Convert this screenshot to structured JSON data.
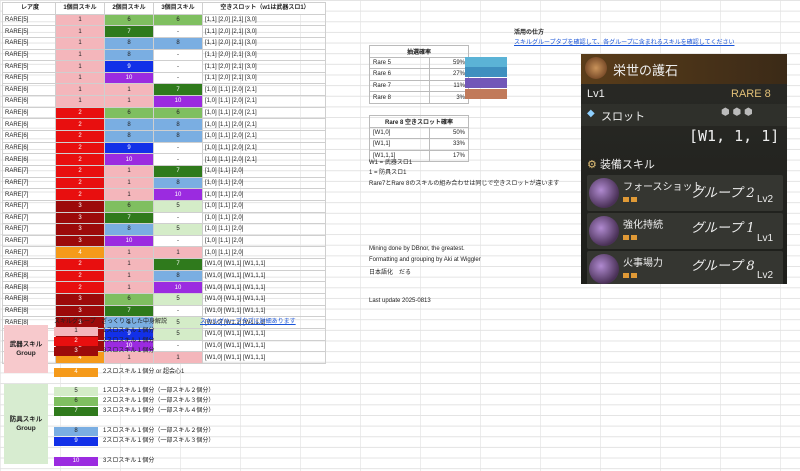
{
  "sheet": {
    "headers": [
      "レア度",
      "1個目スキル",
      "2個目スキル",
      "3個目スキル",
      "空きスロット（w1は武器スロ1）"
    ],
    "rows": [
      {
        "r": "RARE[5]",
        "s1": "1",
        "s2": "6",
        "s3": "6",
        "slot": "[1,1] [2,0] [2,1] [3,0]",
        "k1": "p",
        "k2": "g6",
        "k3": "g6",
        "sep": false
      },
      {
        "r": "RARE[5]",
        "s1": "1",
        "s2": "7",
        "s3": "-",
        "slot": "[1,1] [2,0] [2,1] [3,0]",
        "k1": "p",
        "k2": "g7",
        "k3": "w",
        "sep": false
      },
      {
        "r": "RARE[5]",
        "s1": "1",
        "s2": "8",
        "s3": "8",
        "slot": "[1,1] [2,0] [2,1] [3,0]",
        "k1": "p",
        "k2": "b8",
        "k3": "b8",
        "sep": false
      },
      {
        "r": "RARE[5]",
        "s1": "1",
        "s2": "8",
        "s3": "-",
        "slot": "[1,1] [2,0] [2,1] [3,0]",
        "k1": "p",
        "k2": "b8",
        "k3": "w",
        "sep": false
      },
      {
        "r": "RARE[5]",
        "s1": "1",
        "s2": "9",
        "s3": "-",
        "slot": "[1,1] [2,0] [2,1] [3,0]",
        "k1": "p",
        "k2": "b9",
        "k3": "w",
        "sep": false
      },
      {
        "r": "RARE[5]",
        "s1": "1",
        "s2": "10",
        "s3": "-",
        "slot": "[1,1] [2,0] [2,1] [3,0]",
        "k1": "p",
        "k2": "v10",
        "k3": "w",
        "sep": false
      },
      {
        "r": "RARE[6]",
        "s1": "1",
        "s2": "1",
        "s3": "7",
        "slot": "[1,0] [1,1] [2,0] [2,1]",
        "k1": "p",
        "k2": "p",
        "k3": "g7",
        "sep": true
      },
      {
        "r": "RARE[6]",
        "s1": "1",
        "s2": "1",
        "s3": "10",
        "slot": "[1,0] [1,1] [2,0] [2,1]",
        "k1": "p",
        "k2": "p",
        "k3": "v10",
        "sep": false
      },
      {
        "r": "RARE[6]",
        "s1": "2",
        "s2": "6",
        "s3": "6",
        "slot": "[1,0] [1,1] [2,0] [2,1]",
        "k1": "r2",
        "k2": "g6",
        "k3": "g6",
        "sep": false
      },
      {
        "r": "RARE[6]",
        "s1": "2",
        "s2": "8",
        "s3": "8",
        "slot": "[1,0] [1,1] [2,0] [2,1]",
        "k1": "r2",
        "k2": "b8",
        "k3": "b8",
        "sep": false
      },
      {
        "r": "RARE[6]",
        "s1": "2",
        "s2": "8",
        "s3": "8",
        "slot": "[1,0] [1,1] [2,0] [2,1]",
        "k1": "r2",
        "k2": "b8",
        "k3": "b8",
        "sep": false
      },
      {
        "r": "RARE[6]",
        "s1": "2",
        "s2": "9",
        "s3": "-",
        "slot": "[1,0] [1,1] [2,0] [2,1]",
        "k1": "r2",
        "k2": "b9",
        "k3": "w",
        "sep": false
      },
      {
        "r": "RARE[6]",
        "s1": "2",
        "s2": "10",
        "s3": "-",
        "slot": "[1,0] [1,1] [2,0] [2,1]",
        "k1": "r2",
        "k2": "v10",
        "k3": "w",
        "sep": false
      },
      {
        "r": "RARE[7]",
        "s1": "2",
        "s2": "1",
        "s3": "7",
        "slot": "[1,0] [1,1] [2,0]",
        "k1": "r2",
        "k2": "p",
        "k3": "g7",
        "sep": true
      },
      {
        "r": "RARE[7]",
        "s1": "2",
        "s2": "1",
        "s3": "8",
        "slot": "[1,0] [1,1] [2,0]",
        "k1": "r2",
        "k2": "p",
        "k3": "b8",
        "sep": false
      },
      {
        "r": "RARE[7]",
        "s1": "2",
        "s2": "1",
        "s3": "10",
        "slot": "[1,0] [1,1] [2,0]",
        "k1": "r2",
        "k2": "p",
        "k3": "v10",
        "sep": false
      },
      {
        "r": "RARE[7]",
        "s1": "3",
        "s2": "6",
        "s3": "5",
        "slot": "[1,0] [1,1] [2,0]",
        "k1": "r3",
        "k2": "g6",
        "k3": "g5",
        "sep": false
      },
      {
        "r": "RARE[7]",
        "s1": "3",
        "s2": "7",
        "s3": "-",
        "slot": "[1,0] [1,1] [2,0]",
        "k1": "r3",
        "k2": "g7",
        "k3": "w",
        "sep": false
      },
      {
        "r": "RARE[7]",
        "s1": "3",
        "s2": "8",
        "s3": "5",
        "slot": "[1,0] [1,1] [2,0]",
        "k1": "r3",
        "k2": "b8",
        "k3": "g5",
        "sep": false
      },
      {
        "r": "RARE[7]",
        "s1": "3",
        "s2": "10",
        "s3": "-",
        "slot": "[1,0] [1,1] [2,0]",
        "k1": "r3",
        "k2": "v10",
        "k3": "w",
        "sep": false
      },
      {
        "r": "RARE[7]",
        "s1": "4",
        "s2": "1",
        "s3": "1",
        "slot": "[1,0] [1,1] [2,0]",
        "k1": "o4",
        "k2": "p",
        "k3": "p",
        "sep": false
      },
      {
        "r": "RARE[8]",
        "s1": "2",
        "s2": "1",
        "s3": "7",
        "slot": "[W1,0] [W1,1] [W1,1,1]",
        "k1": "r2",
        "k2": "p",
        "k3": "g7",
        "sep": true
      },
      {
        "r": "RARE[8]",
        "s1": "2",
        "s2": "1",
        "s3": "8",
        "slot": "[W1,0] [W1,1] [W1,1,1]",
        "k1": "r2",
        "k2": "p",
        "k3": "b8",
        "sep": false
      },
      {
        "r": "RARE[8]",
        "s1": "2",
        "s2": "1",
        "s3": "10",
        "slot": "[W1,0] [W1,1] [W1,1,1]",
        "k1": "r2",
        "k2": "p",
        "k3": "v10",
        "sep": false
      },
      {
        "r": "RARE[8]",
        "s1": "3",
        "s2": "6",
        "s3": "5",
        "slot": "[W1,0] [W1,1] [W1,1,1]",
        "k1": "r3",
        "k2": "g6",
        "k3": "g5",
        "sep": false
      },
      {
        "r": "RARE[8]",
        "s1": "3",
        "s2": "7",
        "s3": "-",
        "slot": "[W1,0] [W1,1] [W1,1,1]",
        "k1": "r3",
        "k2": "g7",
        "k3": "w",
        "sep": false
      },
      {
        "r": "RARE[8]",
        "s1": "3",
        "s2": "8",
        "s3": "5",
        "slot": "[W1,0] [W1,1] [W1,1,1]",
        "k1": "r3",
        "k2": "b8",
        "k3": "g5",
        "sep": false
      },
      {
        "r": "RARE[8]",
        "s1": "3",
        "s2": "9",
        "s3": "5",
        "slot": "[W1,0] [W1,1] [W1,1,1]",
        "k1": "r3",
        "k2": "b9",
        "k3": "g5",
        "sep": false
      },
      {
        "r": "RARE[8]",
        "s1": "3",
        "s2": "10",
        "s3": "-",
        "slot": "[W1,0] [W1,1] [W1,1,1]",
        "k1": "r3",
        "k2": "v10",
        "k3": "w",
        "sep": false
      },
      {
        "r": "RARE[8]",
        "s1": "4",
        "s2": "1",
        "s3": "1",
        "slot": "[W1,0] [W1,1] [W1,1,1]",
        "k1": "o4",
        "k2": "p",
        "k3": "p",
        "sep": false
      }
    ]
  },
  "colors": {
    "p": "#f4b6bb",
    "r2": "#e80f0f",
    "r3": "#9c0a0a",
    "o4": "#f59a1a",
    "g5": "#d4ecc8",
    "g6": "#7fbf60",
    "g7": "#2f7a1c",
    "b8": "#7aaee2",
    "b9": "#1230e8",
    "v10": "#9b2be0",
    "w": "#ffffff"
  },
  "lottery": {
    "title": "抽選確率",
    "rows": [
      {
        "label": "Rare 5",
        "pct": "59%",
        "color": "#5bb3d6"
      },
      {
        "label": "Rare 6",
        "pct": "27%",
        "color": "#3f8fbf"
      },
      {
        "label": "Rare 7",
        "pct": "11%",
        "color": "#7257b8"
      },
      {
        "label": "Rare 8",
        "pct": "3%",
        "color": "#c17a5a"
      }
    ]
  },
  "slot_prob": {
    "title": "Rare 8 空きスロット確率",
    "rows": [
      {
        "label": "[W1,0]",
        "pct": "50%"
      },
      {
        "label": "[W1,1]",
        "pct": "33%"
      },
      {
        "label": "[W1,1,1]",
        "pct": "17%"
      }
    ]
  },
  "notes": {
    "usage_title": "活用の仕方",
    "usage_link": "スキルグループタブを確認して、各グループに含まれるスキルを確認してください",
    "w1": "W1 = 武器スロ1",
    "one": "1 = 防具スロ1",
    "rare78": "Rare7とRare 8のスキルの組み合わせは同じで空きスロットが違います",
    "credit1": "Mining done by DBnor, the greatest.",
    "credit2": "Formatting and grouping by Aki at Wiggler",
    "credit3": "日本語化　だる",
    "update": "Last update 2025-0813"
  },
  "legend": {
    "col_header": "スキルグループ",
    "desc_header": "ざっくりとした中身解説",
    "detail_link": "スキルグループタブに詳細あります",
    "weapon_group": "武器スキル\nGroup",
    "armor_group": "防具スキル\nGroup",
    "items": [
      {
        "id": "1",
        "k": "p",
        "text": "1スロスキル１個分"
      },
      {
        "id": "2",
        "k": "r2",
        "text": "2スロスキル１個分"
      },
      {
        "id": "3",
        "k": "r3",
        "text": "3スロスキル１個分"
      },
      {
        "id": "4",
        "k": "o4",
        "text": "2スロスキル１個分 or 超会心1"
      },
      {
        "id": "5",
        "k": "g5",
        "text": "1スロスキル１個分（一部スキル２個分）"
      },
      {
        "id": "6",
        "k": "g6",
        "text": "2スロスキル１個分（一部スキル３個分）"
      },
      {
        "id": "7",
        "k": "g7",
        "text": "3スロスキル１個分（一部スキル４個分）"
      },
      {
        "id": "8",
        "k": "b8",
        "text": "1スロスキル１個分（一部スキル２個分）"
      },
      {
        "id": "9",
        "k": "b9",
        "text": "2スロスキル１個分（一部スキル３個分）"
      },
      {
        "id": "10",
        "k": "v10",
        "text": "3スロスキル１個分"
      }
    ]
  },
  "game": {
    "title": "栄世の護石",
    "level": "Lv1",
    "rarity": "RARE 8",
    "slot_label": "スロット",
    "slot_value": "[W1, 1, 1]",
    "skills_header": "装備スキル",
    "skills": [
      {
        "name": "フォースショット",
        "note": "グループ 2",
        "level": "Lv2"
      },
      {
        "name": "強化持続",
        "note": "グループ 1",
        "level": "Lv1"
      },
      {
        "name": "火事場力",
        "note": "グループ 8",
        "level": "Lv2"
      }
    ]
  }
}
